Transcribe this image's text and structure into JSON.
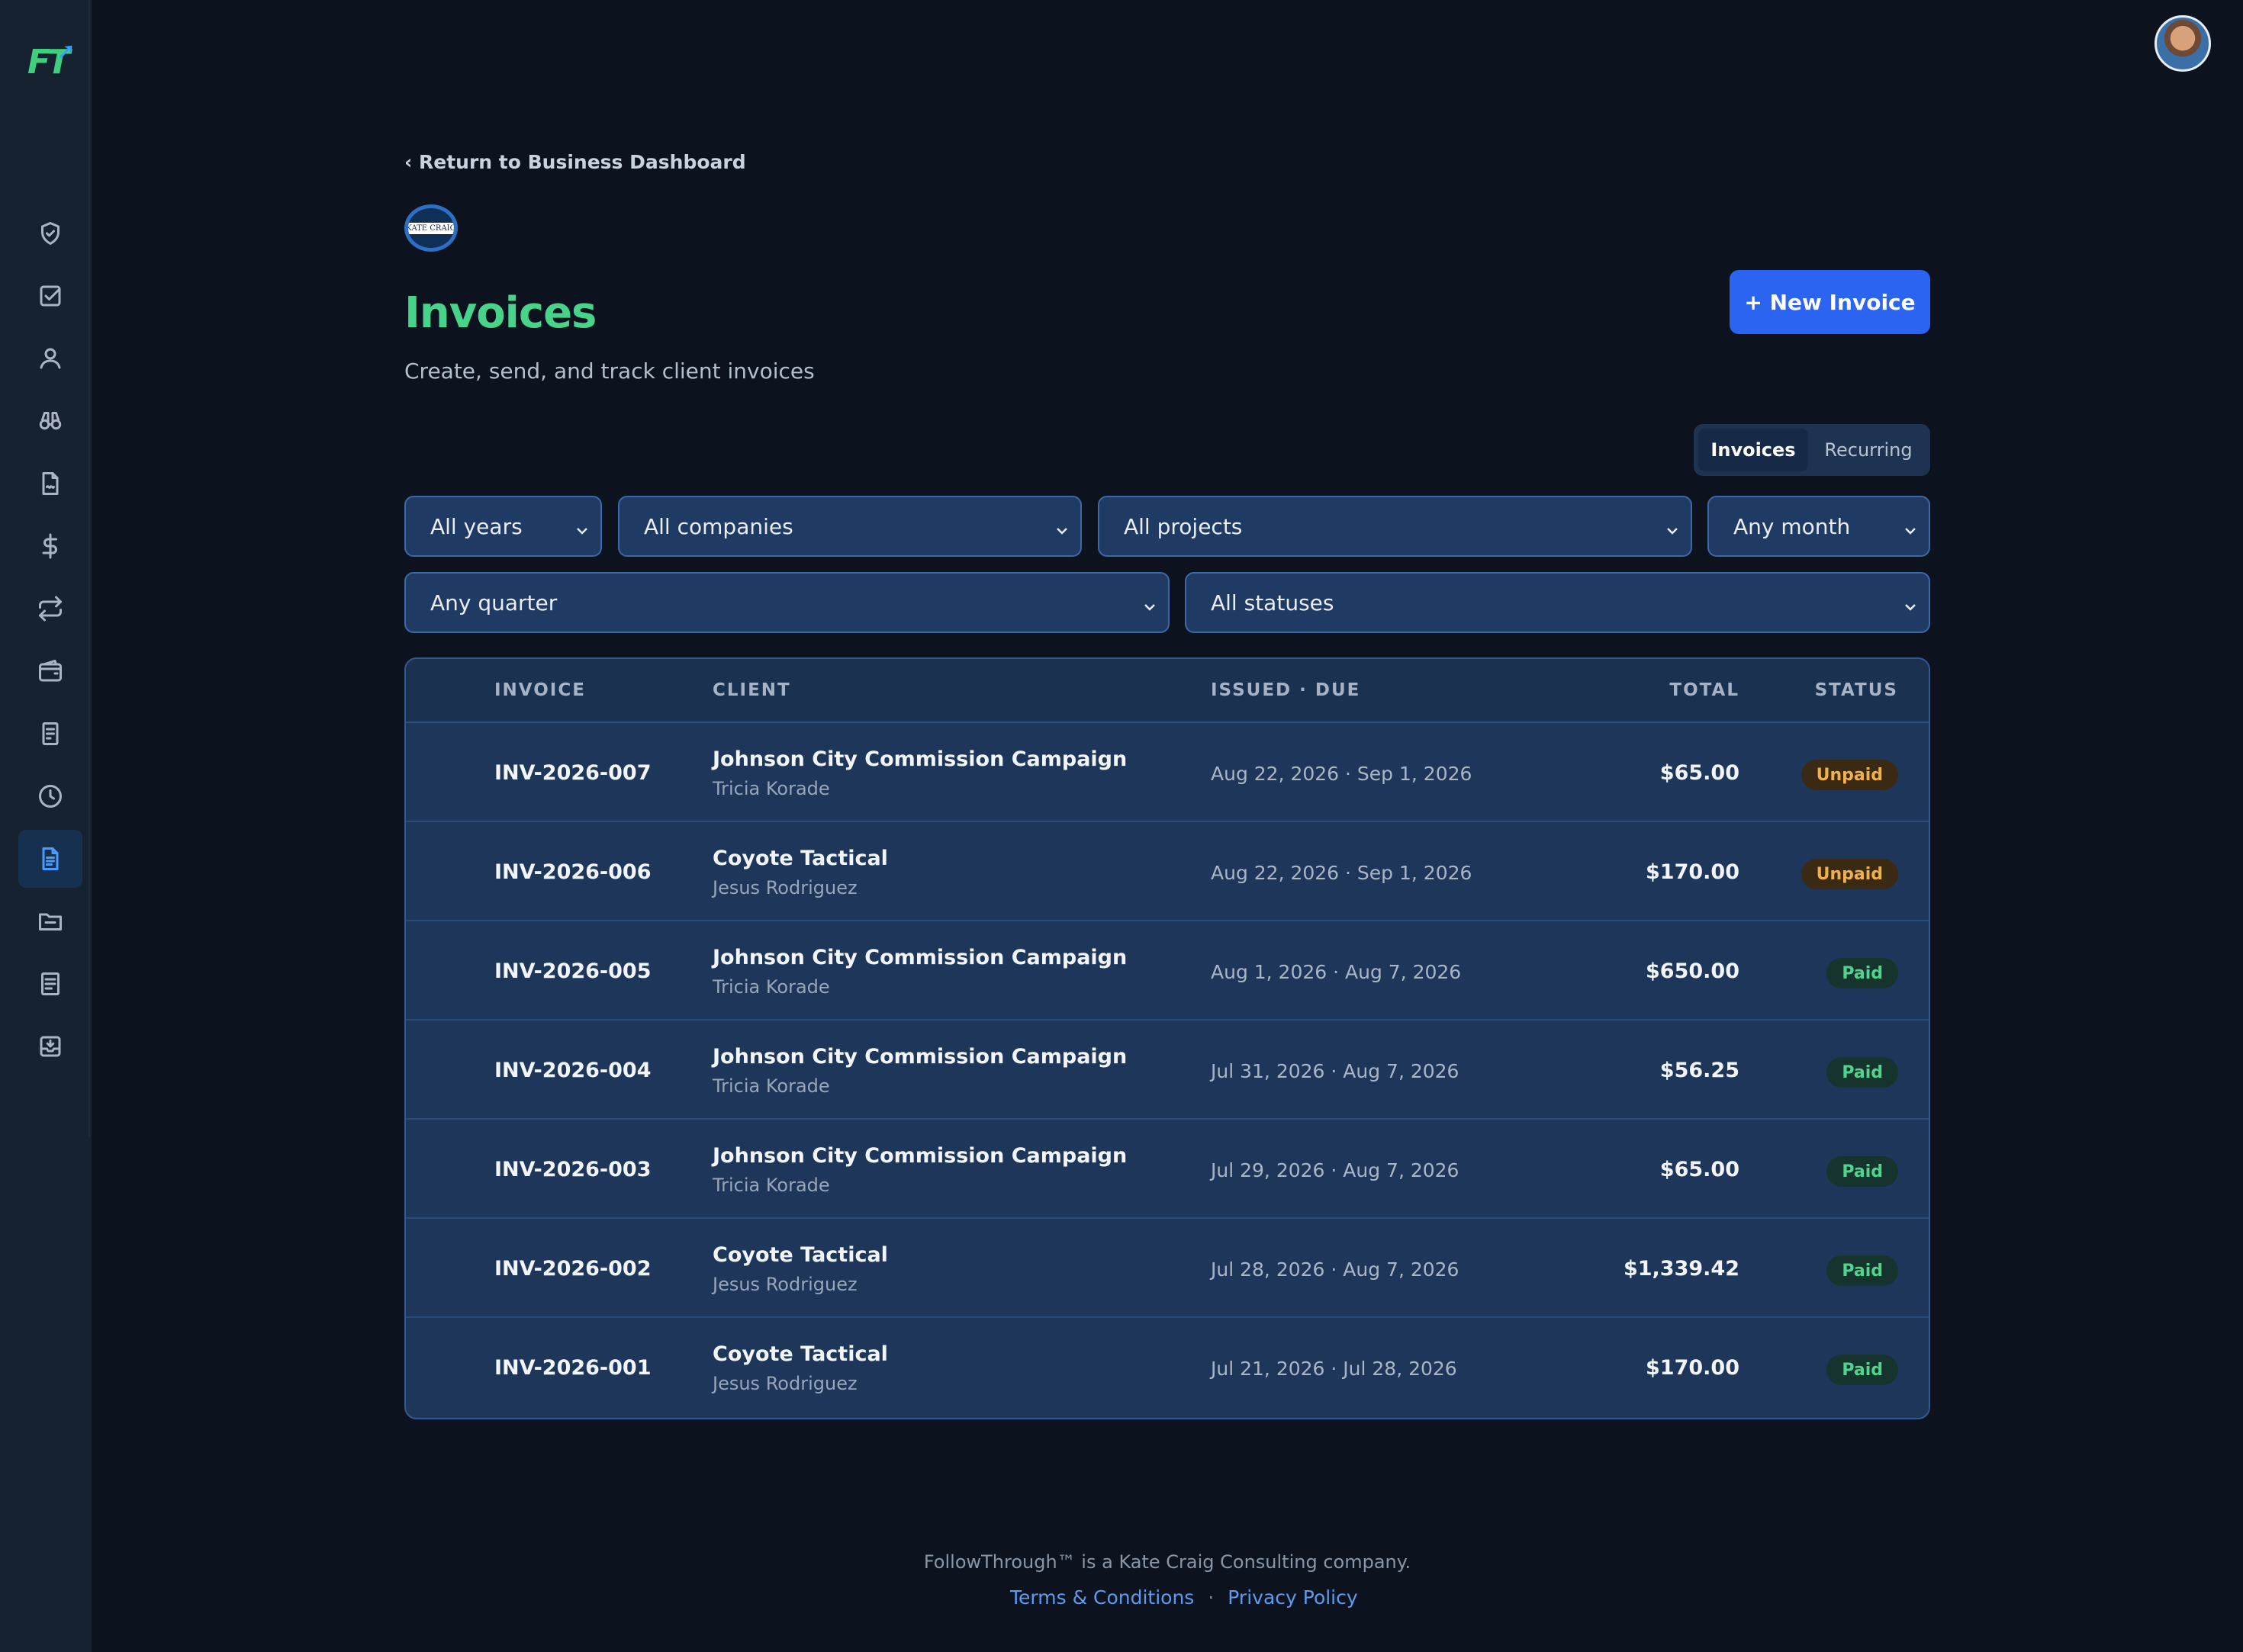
{
  "app": {
    "logo_text": "FT"
  },
  "nav": {
    "back_label": "‹ Return to Business Dashboard"
  },
  "company_logo_text": "KATE CRAIG",
  "header": {
    "title": "Invoices",
    "subtitle": "Create, send, and track client invoices",
    "new_button": "+ New Invoice"
  },
  "view_toggle": {
    "invoices": "Invoices",
    "recurring": "Recurring",
    "active": "Invoices"
  },
  "filters": {
    "year": "All years",
    "company": "All companies",
    "project": "All projects",
    "month": "Any month",
    "quarter": "Any quarter",
    "status": "All statuses"
  },
  "table": {
    "headers": {
      "invoice": "INVOICE",
      "client": "CLIENT",
      "dates": "ISSUED · DUE",
      "total": "TOTAL",
      "status": "STATUS"
    },
    "rows": [
      {
        "invoice": "INV-2026-007",
        "client": "Johnson City Commission Campaign",
        "contact": "Tricia Korade",
        "dates": "Aug 22, 2026 · Sep 1, 2026",
        "total": "$65.00",
        "status": "Unpaid"
      },
      {
        "invoice": "INV-2026-006",
        "client": "Coyote Tactical",
        "contact": "Jesus Rodriguez",
        "dates": "Aug 22, 2026 · Sep 1, 2026",
        "total": "$170.00",
        "status": "Unpaid"
      },
      {
        "invoice": "INV-2026-005",
        "client": "Johnson City Commission Campaign",
        "contact": "Tricia Korade",
        "dates": "Aug 1, 2026 · Aug 7, 2026",
        "total": "$650.00",
        "status": "Paid"
      },
      {
        "invoice": "INV-2026-004",
        "client": "Johnson City Commission Campaign",
        "contact": "Tricia Korade",
        "dates": "Jul 31, 2026 · Aug 7, 2026",
        "total": "$56.25",
        "status": "Paid"
      },
      {
        "invoice": "INV-2026-003",
        "client": "Johnson City Commission Campaign",
        "contact": "Tricia Korade",
        "dates": "Jul 29, 2026 · Aug 7, 2026",
        "total": "$65.00",
        "status": "Paid"
      },
      {
        "invoice": "INV-2026-002",
        "client": "Coyote Tactical",
        "contact": "Jesus Rodriguez",
        "dates": "Jul 28, 2026 · Aug 7, 2026",
        "total": "$1,339.42",
        "status": "Paid"
      },
      {
        "invoice": "INV-2026-001",
        "client": "Coyote Tactical",
        "contact": "Jesus Rodriguez",
        "dates": "Jul 21, 2026 · Jul 28, 2026",
        "total": "$170.00",
        "status": "Paid"
      }
    ]
  },
  "footer": {
    "text": "FollowThrough™ is a Kate Craig Consulting company.",
    "terms": "Terms & Conditions",
    "separator": "·",
    "privacy": "Privacy Policy"
  },
  "colors": {
    "accent": "#2a64f0",
    "title_green": "#47d38a",
    "paid": "#4fd58e",
    "unpaid": "#f0b04a"
  },
  "sidebar_icons": [
    "shield-check-icon",
    "checkbox-icon",
    "user-icon",
    "binoculars-icon",
    "document-icon",
    "dollar-icon",
    "repeat-icon",
    "wallet-icon",
    "receipt-icon",
    "clock-icon",
    "invoice-icon",
    "folder-icon",
    "report-icon",
    "inbox-icon"
  ],
  "active_nav": "invoice-icon"
}
